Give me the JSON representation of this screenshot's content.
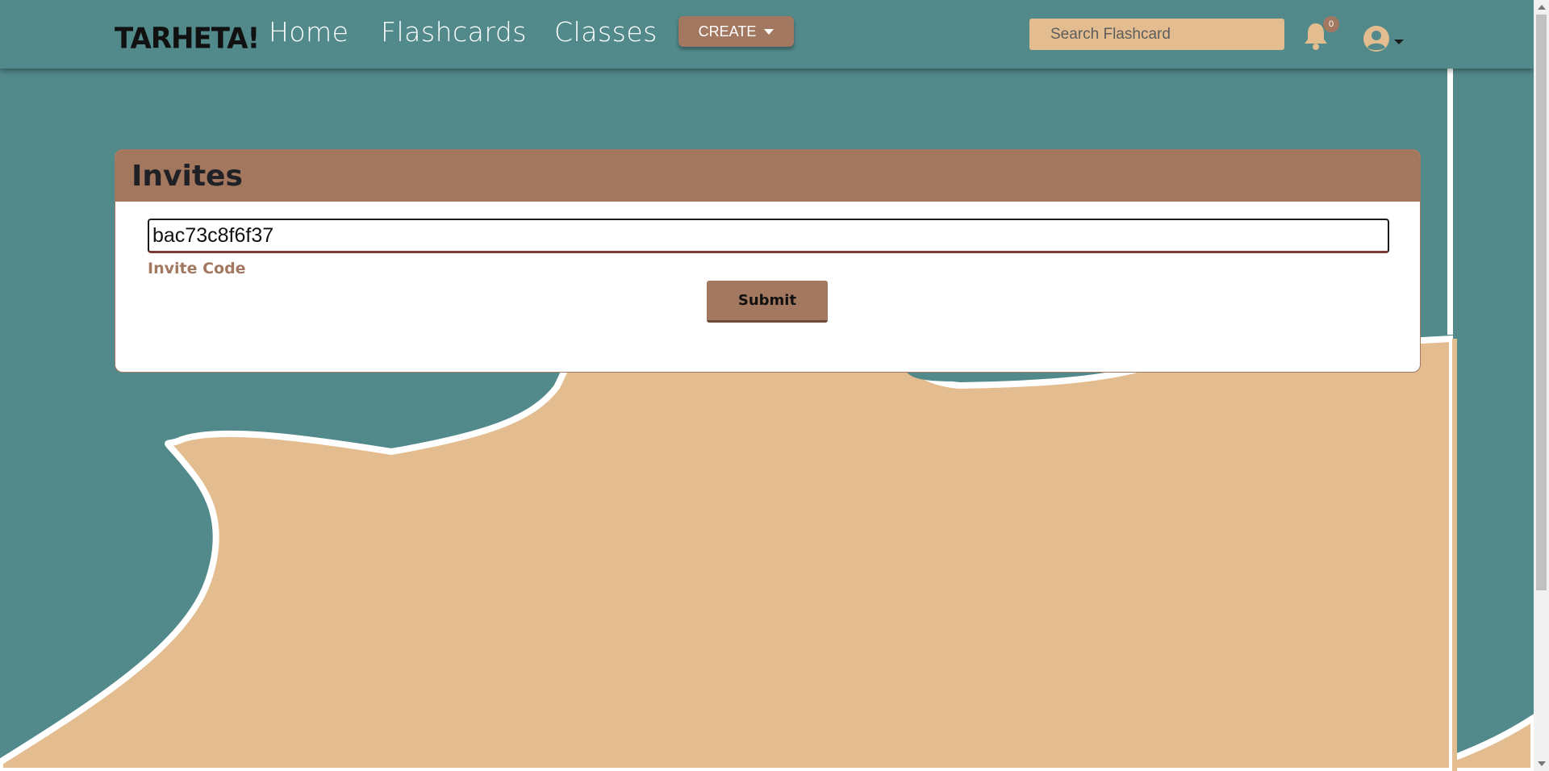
{
  "navbar": {
    "logo": "TARHETA!",
    "links": [
      "Home",
      "Flashcards",
      "Classes"
    ],
    "create_label": "CREATE",
    "search_placeholder": "Search Flashcard",
    "notification_count": "0"
  },
  "invites": {
    "title": "Invites",
    "code_value": "bac73c8f6f37",
    "code_label": "Invite Code",
    "submit_label": "Submit"
  },
  "colors": {
    "teal": "#52898a",
    "brown": "#a37860",
    "sand": "#e3bd90",
    "white": "#ffffff"
  },
  "icons": [
    "bell-icon",
    "user-avatar-icon",
    "caret-down-icon"
  ]
}
